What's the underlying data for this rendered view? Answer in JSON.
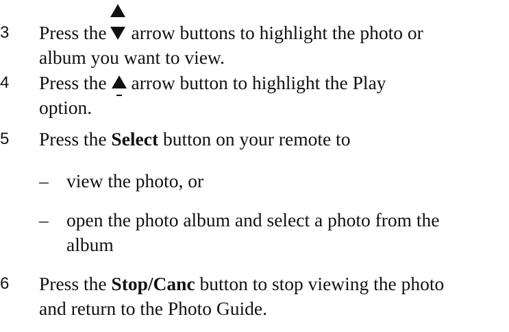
{
  "steps": [
    {
      "number": "3",
      "text_before": "Press the",
      "text_after": "arrow buttons to highlight the photo or",
      "line2": "album you want to view."
    },
    {
      "number": "4",
      "text_before": "Press the",
      "text_after": "arrow button to highlight the Play",
      "line2": "option."
    },
    {
      "number": "5",
      "text_before": "Press the",
      "bold": "Select",
      "text_after": "button on your remote to"
    },
    {
      "number": "6",
      "text_before": "Press the",
      "bold": "Stop/Canc",
      "text_after": "button to stop viewing the photo",
      "line2": "and return to the Photo Guide."
    }
  ],
  "bullets": [
    {
      "dash": "–",
      "line1": "view the photo, or"
    },
    {
      "dash": "–",
      "line1": "open the photo album and select a photo from the",
      "line2": "album"
    }
  ],
  "icons": {
    "up_down": "up-down-arrow-icon",
    "up": "up-arrow-icon"
  }
}
